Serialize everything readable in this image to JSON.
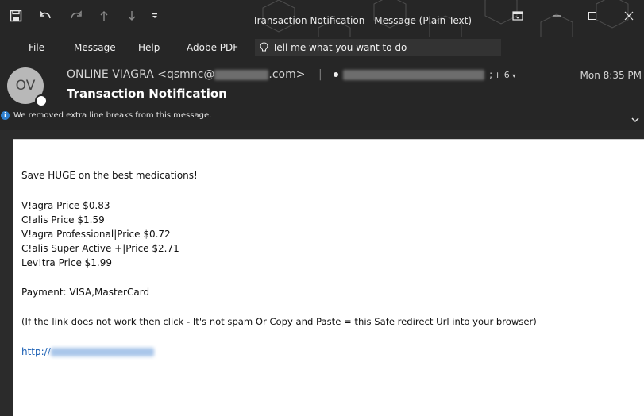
{
  "window": {
    "title": "Transaction Notification  -  Message (Plain Text)"
  },
  "menu": {
    "items": [
      "File",
      "Message",
      "Help",
      "Adobe PDF"
    ],
    "tell_me": "Tell me what you want to do"
  },
  "message": {
    "avatar_initials": "OV",
    "from_name": "ONLINE VIAGRA <qsmnc@",
    "from_domain": ".com>",
    "separator": "|",
    "recipient_suffix": ";",
    "more_recipients": "+ 6",
    "date": "Mon 8:35 PM",
    "subject": "Transaction Notification",
    "info_bar": "We removed extra line breaks from this message."
  },
  "body": {
    "lines": [
      "Save HUGE on the best medications!",
      "V!agra Price $0.83",
      "C!alis Price $1.59",
      "V!agra Professional|Price $0.72",
      "C!alis Super Active +|Price $2.71",
      "Lev!tra Price $1.99",
      "Payment: VISA,MasterCard",
      "(If the link does not work then click - It's not spam Or Copy and Paste = this Safe redirect Url into your browser)"
    ],
    "link_prefix": "http://"
  },
  "icons": {
    "save": "save-icon",
    "undo": "undo-icon",
    "redo": "redo-icon",
    "up": "arrow-up-icon",
    "down": "arrow-down-icon",
    "qat_more": "customize-toolbar-icon",
    "ribbon_display": "ribbon-display-options-icon",
    "minimize": "minimize-icon",
    "maximize": "maximize-icon",
    "close": "close-icon",
    "lightbulb": "lightbulb-icon",
    "info": "info-icon",
    "expand": "chevron-down-icon"
  },
  "colors": {
    "chrome": "#262626",
    "body_bg": "#ffffff",
    "link": "#1a5fb4",
    "info": "#2e7fcf"
  }
}
